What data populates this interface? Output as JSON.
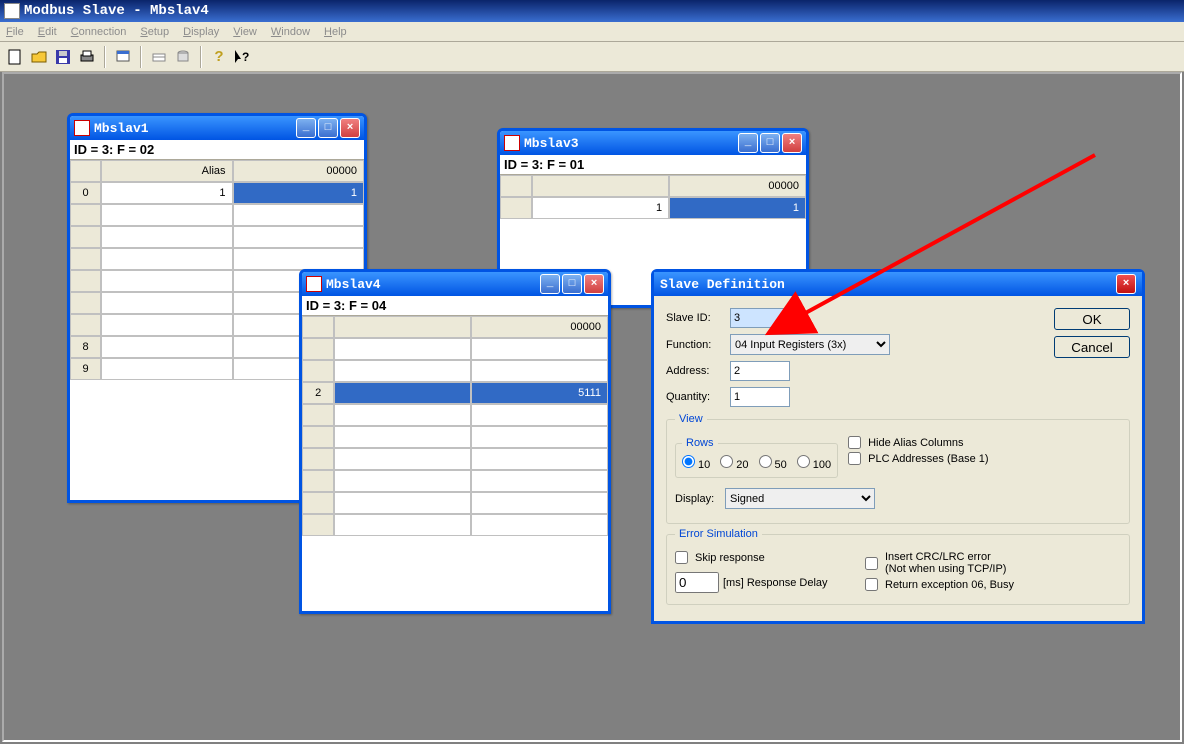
{
  "app_title": "Modbus Slave - Mbslav4",
  "menu": {
    "file": "File",
    "edit": "Edit",
    "connection": "Connection",
    "setup": "Setup",
    "display": "Display",
    "view": "View",
    "window": "Window",
    "help": "Help"
  },
  "windows": {
    "w1": {
      "title": "Mbslav1",
      "status": "ID = 3: F = 02",
      "hdr_alias": "Alias",
      "hdr_val": "00000",
      "rows": [
        {
          "n": "0",
          "alias": "1",
          "val": "1"
        },
        {
          "n": ""
        },
        {
          "n": ""
        },
        {
          "n": ""
        },
        {
          "n": ""
        },
        {
          "n": ""
        },
        {
          "n": ""
        },
        {
          "n": "8"
        },
        {
          "n": "9"
        }
      ]
    },
    "w3": {
      "title": "Mbslav3",
      "status": "ID = 3: F = 01",
      "hdr_alias": "",
      "hdr_val": "00000",
      "rows": [
        {
          "n": "",
          "alias": "1",
          "val": "1"
        }
      ]
    },
    "w4": {
      "title": "Mbslav4",
      "status": "ID = 3: F = 04",
      "hdr_alias": "",
      "hdr_val": "00000",
      "rows": [
        {
          "n": ""
        },
        {
          "n": ""
        },
        {
          "n": "2",
          "alias": "",
          "val": "5111"
        },
        {
          "n": ""
        },
        {
          "n": ""
        },
        {
          "n": ""
        },
        {
          "n": ""
        },
        {
          "n": ""
        },
        {
          "n": ""
        }
      ]
    }
  },
  "dialog": {
    "title": "Slave Definition",
    "slave_id_label": "Slave ID:",
    "slave_id": "3",
    "function_label": "Function:",
    "function": "04 Input Registers (3x)",
    "address_label": "Address:",
    "address": "2",
    "quantity_label": "Quantity:",
    "quantity": "1",
    "ok": "OK",
    "cancel": "Cancel",
    "view_legend": "View",
    "rows_legend": "Rows",
    "rows_opts": {
      "r10": "10",
      "r20": "20",
      "r50": "50",
      "r100": "100"
    },
    "hide_alias": "Hide Alias Columns",
    "plc_addr": "PLC Addresses (Base 1)",
    "display_label": "Display:",
    "display_value": "Signed",
    "error_legend": "Error Simulation",
    "skip_response": "Skip response",
    "delay_value": "0",
    "delay_suffix": "[ms] Response Delay",
    "insert_crc": "Insert CRC/LRC error",
    "insert_crc_note": "(Not when using TCP/IP)",
    "return_exc": "Return exception 06, Busy"
  }
}
